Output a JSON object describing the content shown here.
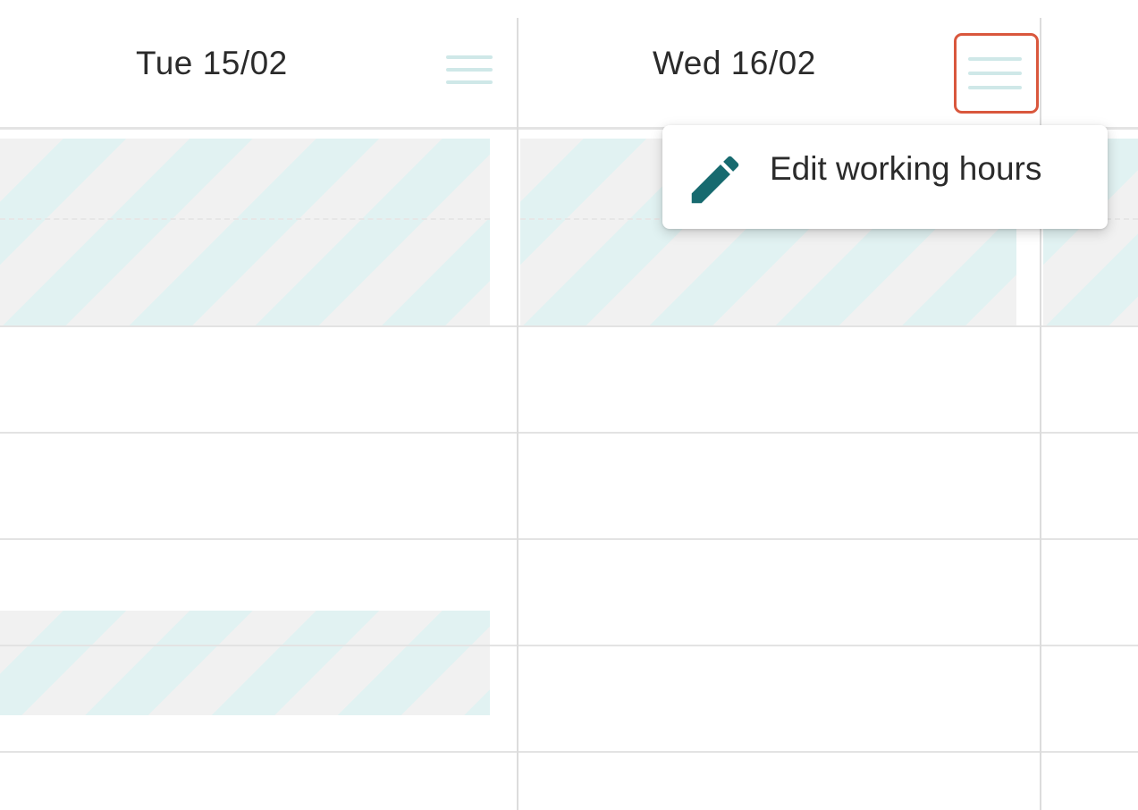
{
  "days": [
    {
      "label": "Tue 15/02",
      "menu_icon": "hamburger-menu-icon"
    },
    {
      "label": "Wed 16/02",
      "menu_icon": "hamburger-menu-icon"
    }
  ],
  "context_menu": {
    "items": [
      {
        "label": "Edit working hours",
        "icon": "pencil-icon"
      }
    ]
  },
  "colors": {
    "menu_icon": "#cfe8e8",
    "highlight_border": "#d9573d",
    "stripe_teal": "#e1f2f2",
    "stripe_grey": "#f1f1f1",
    "pencil": "#176a6f",
    "gridline": "#e3e3e3"
  }
}
